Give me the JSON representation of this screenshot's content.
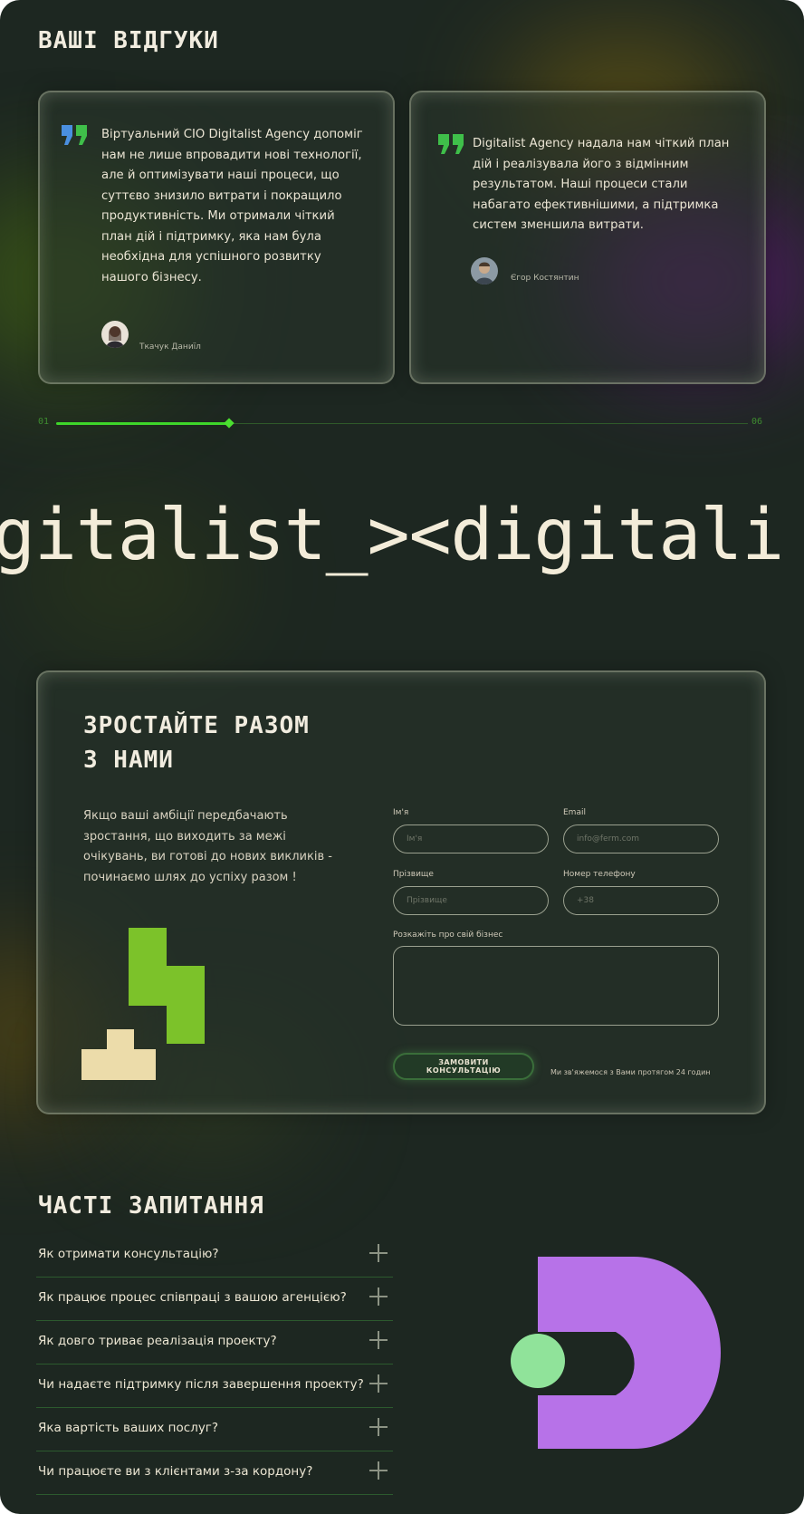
{
  "reviews": {
    "title": "ВАШІ ВІДГУКИ",
    "items": [
      {
        "text": "Віртуальний CIO Digitalist Agency допоміг нам не лише впровадити нові технології, але й оптимізувати наші процеси, що суттєво знизило витрати і покращило продуктивність. Ми отримали чіткий план дій і підтримку, яка нам була необхідна для успішного розвитку нашого бізнесу.",
        "author": "Ткачук Даниїл",
        "quote_icon": "quote-icon",
        "quote_colors": [
          "#4a8fe0",
          "#3fbf4a"
        ]
      },
      {
        "text": "Digitalist Agency надала нам чіткий план дій і реалізувала його з відмінним результатом. Наші процеси стали набагато ефективнішими, а підтримка систем зменшила витрати.",
        "author": "Єгор Костянтин",
        "quote_icon": "quote-icon",
        "quote_colors": [
          "#3fbf4a",
          "#3fbf4a"
        ]
      }
    ],
    "slider": {
      "start": "01",
      "end": "06",
      "progress": 0.25
    }
  },
  "marquee": {
    "text": "gitalist_><digitali"
  },
  "contact": {
    "title_line1": "ЗРОСТАЙТЕ РАЗОМ",
    "title_line2": "З НАМИ",
    "description": "Якщо ваші амбіції передбачають зростання, що виходить за межі очікувань, ви готові до нових викликів - починаємо шлях до успіху разом !",
    "fields": {
      "name": {
        "label": "Ім'я",
        "placeholder": "Ім'я"
      },
      "email": {
        "label": "Email",
        "placeholder": "info@ferm.com"
      },
      "surname": {
        "label": "Прізвище",
        "placeholder": "Прізвище"
      },
      "phone": {
        "label": "Номер телефону",
        "placeholder": "+38"
      },
      "business": {
        "label": "Розкажіть про свій бізнес",
        "placeholder": ""
      }
    },
    "submit_label": "ЗАМОВИТИ КОНСУЛЬТАЦІЮ",
    "note": "Ми зв'яжемося з Вами протягом 24 годин",
    "colors": {
      "block_green": "#7cc22a",
      "block_cream": "#ecdcaa"
    }
  },
  "faq": {
    "title": "ЧАСТІ ЗАПИТАННЯ",
    "items": [
      "Як отримати консультацію?",
      "Як працює процес співпраці з вашою агенцією?",
      "Як довго триває реалізація проекту?",
      "Чи надаєте підтримку після завершення проекту?",
      "Яка вартість ваших послуг?",
      "Чи працюєте ви з клієнтами з-за кордону?"
    ],
    "colors": {
      "shape_purple": "#b772e8",
      "circle_green": "#90e39a"
    }
  }
}
